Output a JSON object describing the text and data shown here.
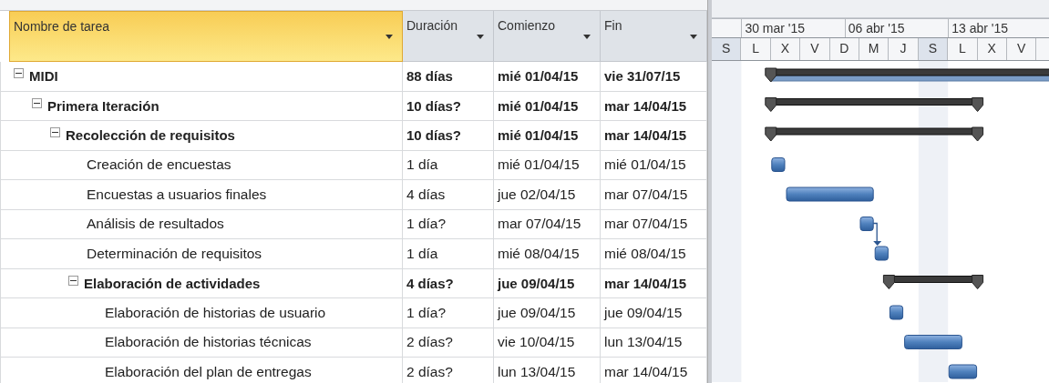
{
  "columns": [
    {
      "label": "Nombre de tarea",
      "selected": true
    },
    {
      "label": "Duración",
      "selected": false
    },
    {
      "label": "Comienzo",
      "selected": false
    },
    {
      "label": "Fin",
      "selected": false
    }
  ],
  "timescale": {
    "weeks": [
      "30 mar '15",
      "06 abr '15",
      "13 abr '15"
    ],
    "days": [
      {
        "label": "S",
        "shaded": true
      },
      {
        "label": "L",
        "shaded": false
      },
      {
        "label": "X",
        "shaded": false
      },
      {
        "label": "V",
        "shaded": false
      },
      {
        "label": "D",
        "shaded": false
      },
      {
        "label": "M",
        "shaded": false
      },
      {
        "label": "J",
        "shaded": false
      },
      {
        "label": "S",
        "shaded": true
      },
      {
        "label": "L",
        "shaded": false
      },
      {
        "label": "X",
        "shaded": false
      },
      {
        "label": "V",
        "shaded": false
      }
    ]
  },
  "tasks": [
    {
      "kind": "project",
      "name": "MIDI",
      "duration": "88 días",
      "start": "mié 01/04/15",
      "finish": "vie 31/07/15",
      "expanded": true,
      "children": [
        {
          "kind": "summary",
          "name": "Primera Iteración",
          "duration": "10 días?",
          "start": "mié 01/04/15",
          "finish": "mar 14/04/15",
          "expanded": true,
          "children": [
            {
              "kind": "summary",
              "name": "Recolección de requisitos",
              "duration": "10 días?",
              "start": "mié 01/04/15",
              "finish": "mar 14/04/15",
              "expanded": true,
              "children": [
                {
                  "kind": "task",
                  "name": "Creación de encuestas",
                  "duration": "1 día",
                  "start": "mié 01/04/15",
                  "finish": "mié 01/04/15",
                  "linked": false
                },
                {
                  "kind": "task",
                  "name": "Encuestas a usuarios finales",
                  "duration": "4 días",
                  "start": "jue 02/04/15",
                  "finish": "mar 07/04/15",
                  "linked": false
                },
                {
                  "kind": "task",
                  "name": "Análisis de resultados",
                  "duration": "1 día?",
                  "start": "mar 07/04/15",
                  "finish": "mar 07/04/15",
                  "linked": true
                },
                {
                  "kind": "task",
                  "name": "Determinación de requisitos",
                  "duration": "1 día",
                  "start": "mié 08/04/15",
                  "finish": "mié 08/04/15",
                  "linked": false
                },
                {
                  "kind": "summary",
                  "name": "Elaboración de actividades",
                  "duration": "4 días?",
                  "start": "jue 09/04/15",
                  "finish": "mar 14/04/15",
                  "expanded": true,
                  "children": [
                    {
                      "kind": "task",
                      "name": "Elaboración de historias de usuario",
                      "duration": "1 día?",
                      "start": "jue 09/04/15",
                      "finish": "jue 09/04/15",
                      "linked": false
                    },
                    {
                      "kind": "task",
                      "name": "Elaboración de historias técnicas",
                      "duration": "2 días?",
                      "start": "vie 10/04/15",
                      "finish": "lun 13/04/15",
                      "linked": false
                    },
                    {
                      "kind": "task",
                      "name": "Elaboración del plan de entregas",
                      "duration": "2 días?",
                      "start": "lun 13/04/15",
                      "finish": "mar 14/04/15",
                      "linked": false
                    }
                  ]
                }
              ]
            }
          ]
        }
      ]
    }
  ]
}
